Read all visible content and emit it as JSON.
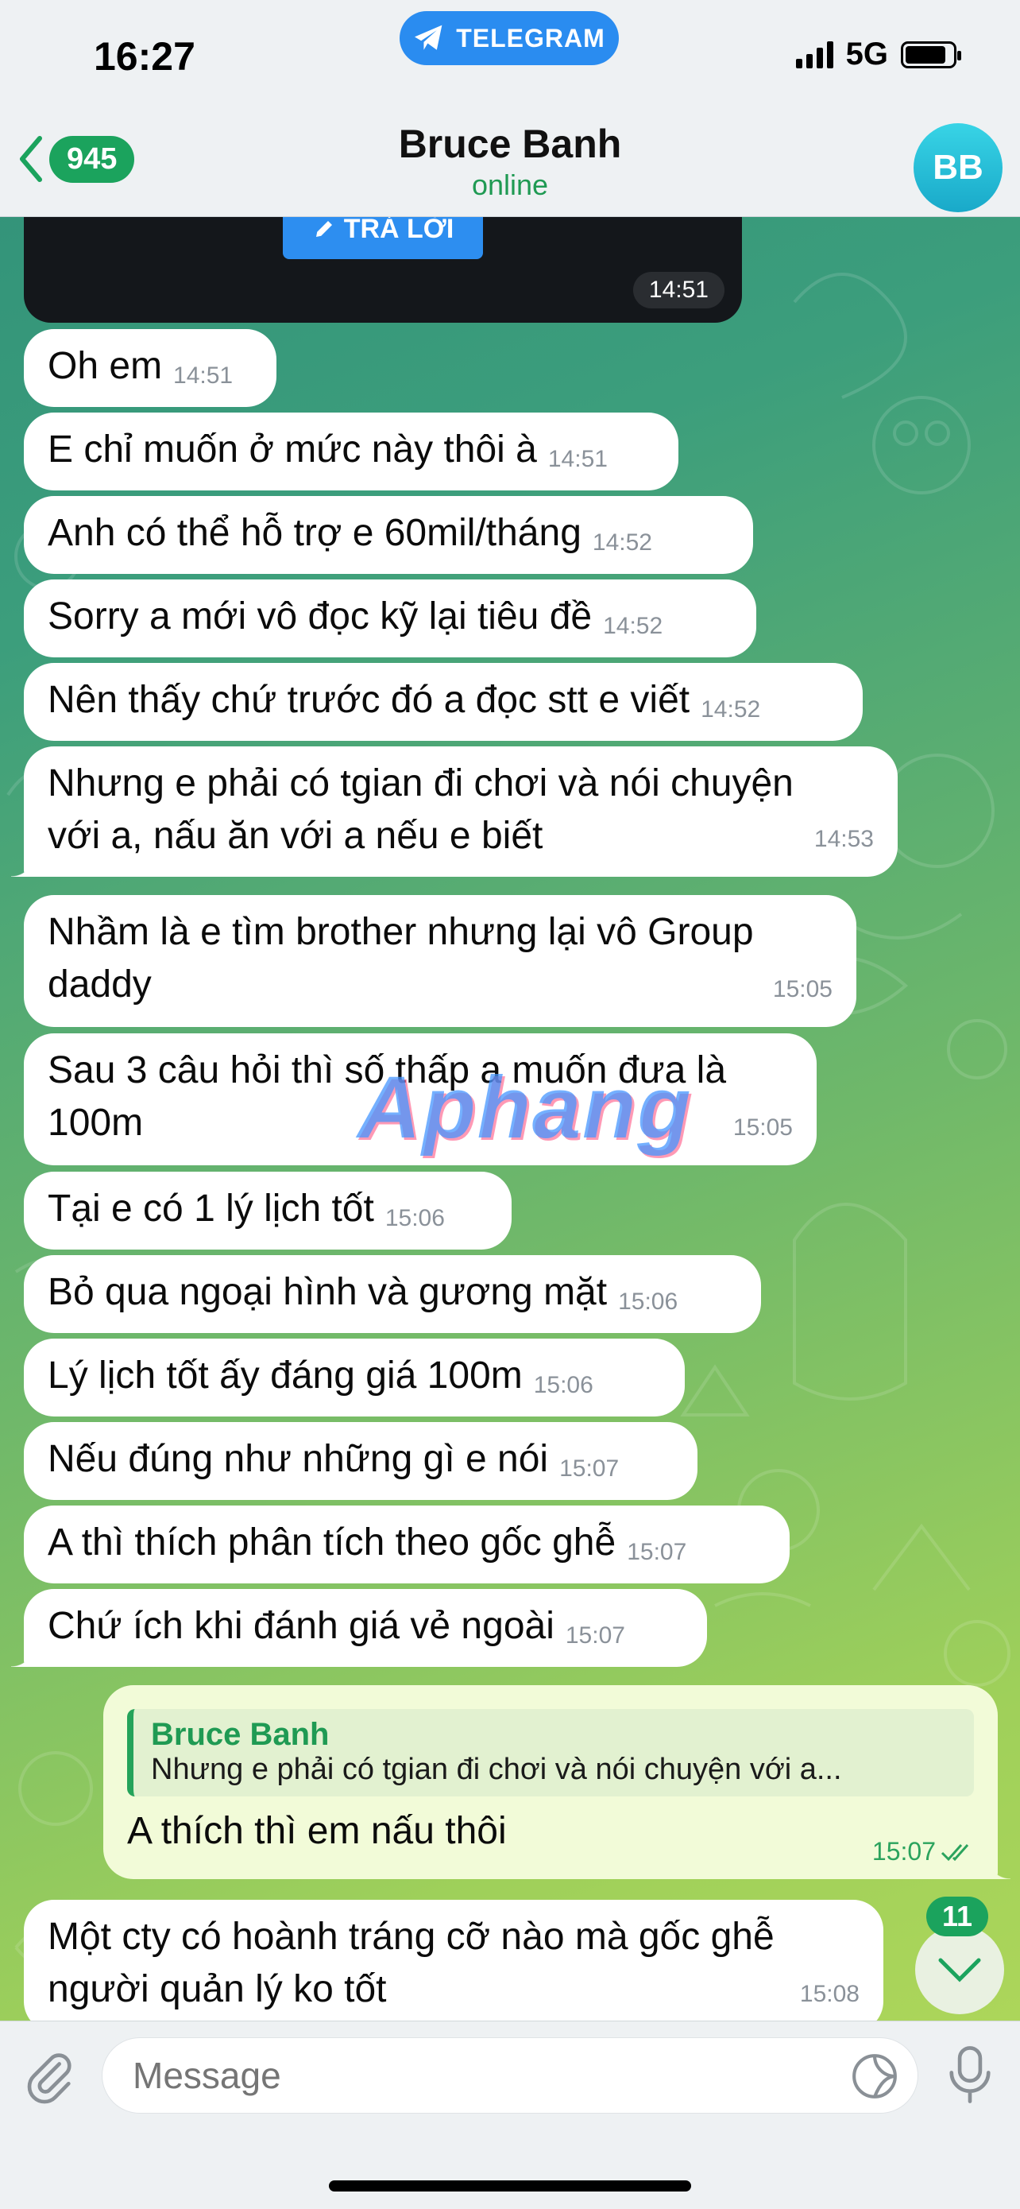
{
  "status_bar": {
    "time": "16:27",
    "pill": "TELEGRAM",
    "network": "5G"
  },
  "header": {
    "back_count": "945",
    "name": "Bruce Banh",
    "status": "online",
    "avatar": "BB"
  },
  "prev_message": {
    "button": "TRẢ LỜI",
    "time": "14:51"
  },
  "messages": [
    {
      "text": "Oh em",
      "time": "14:51"
    },
    {
      "text": "E chỉ muốn ở mức này thôi à",
      "time": "14:51"
    },
    {
      "text": "Anh có thể hỗ trợ e 60mil/tháng",
      "time": "14:52"
    },
    {
      "text": "Sorry a mới vô đọc kỹ lại tiêu đề",
      "time": "14:52"
    },
    {
      "text": "Nên thấy chứ trước đó a đọc stt e viết",
      "time": "14:52"
    },
    {
      "line1": "Nhưng e phải có tgian đi chơi và nói chuyện",
      "line2": "với a, nấu ăn với a nếu e biết",
      "time": "14:53"
    },
    {
      "line1": "Nhầm là e tìm brother nhưng lại vô Group",
      "line2": "daddy",
      "time": "15:05"
    },
    {
      "line1": "Sau 3 câu hỏi thì số thấp a muốn đưa là",
      "line2": "100m",
      "time": "15:05"
    },
    {
      "text": "Tại e có 1 lý lịch tốt",
      "time": "15:06"
    },
    {
      "text": "Bỏ qua ngoại hình và gương mặt",
      "time": "15:06"
    },
    {
      "text": "Lý lịch tốt ấy đáng giá 100m",
      "time": "15:06"
    },
    {
      "text": "Nếu đúng như những gì e nói",
      "time": "15:07"
    },
    {
      "text": "A thì thích phân tích theo gốc ghễ",
      "time": "15:07"
    },
    {
      "text": "Chứ ích khi đánh giá vẻ ngoài",
      "time": "15:07"
    },
    {
      "line1": "Một cty có hoành tráng cỡ nào mà gốc ghễ",
      "line2": "người quản lý ko tốt",
      "time": "15:08"
    }
  ],
  "outgoing": {
    "reply_name": "Bruce Banh",
    "reply_text": "Nhưng e phải có tgian đi chơi và nói chuyện với a...",
    "text": "A thích thì em nấu thôi",
    "time": "15:07"
  },
  "unread_count": "11",
  "watermark": "Aphang",
  "input": {
    "placeholder": "Message"
  },
  "colors": {
    "accent_green": "#1ba35d",
    "telegram_blue": "#2a8cf0",
    "outgoing_bubble": "#f2fbd8"
  }
}
